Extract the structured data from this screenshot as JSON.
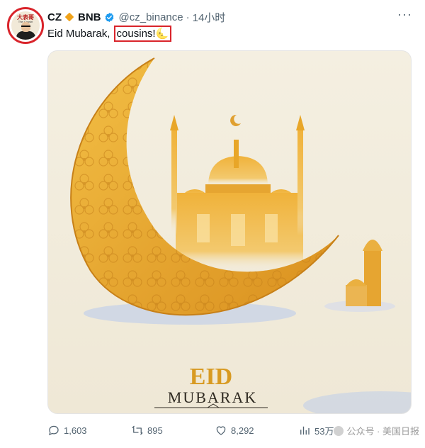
{
  "author": {
    "name": "CZ",
    "token": "BNB",
    "handle": "@cz_binance",
    "separator": "·",
    "time": "14小时",
    "avatar_text": "大表哥",
    "avatar_subtext": "The Cousin"
  },
  "tweet": {
    "text_prefix": "Eid Mubarak, ",
    "text_highlight": "cousins!",
    "emoji": "🌜"
  },
  "media": {
    "title_line1": "EID",
    "title_line2": "MUBARAK"
  },
  "actions": {
    "replies": "1,603",
    "retweets": "895",
    "likes": "8,292",
    "views": "53万"
  },
  "watermark": {
    "text": "公众号 · 美国日报"
  },
  "colors": {
    "highlight_border": "#d9242b",
    "verified_blue": "#1d9bf0",
    "bnb_orange": "#f0a219",
    "secondary_text": "#536471",
    "moon_gold": "#e8a628"
  },
  "icons": [
    "bnb-icon",
    "verified-badge-icon",
    "reply-icon",
    "retweet-icon",
    "like-icon",
    "views-icon",
    "more-icon"
  ]
}
